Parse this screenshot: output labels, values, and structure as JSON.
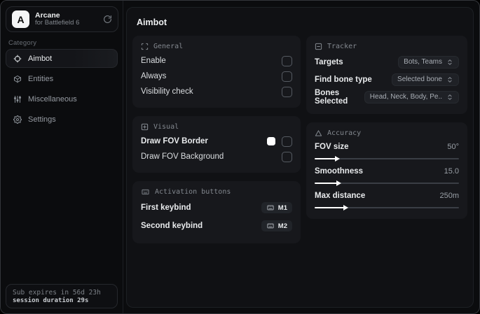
{
  "sidebar": {
    "brand": {
      "logo_letter": "A",
      "name": "Arcane",
      "subtitle": "for Battlefield 6"
    },
    "category_label": "Category",
    "items": [
      {
        "label": "Aimbot"
      },
      {
        "label": "Entities"
      },
      {
        "label": "Miscellaneous"
      },
      {
        "label": "Settings"
      }
    ],
    "subscription": {
      "line1": "Sub expires in 56d 23h",
      "line2": "session duration 29s"
    }
  },
  "main": {
    "title": "Aimbot",
    "general": {
      "title": "General",
      "rows": [
        {
          "label": "Enable",
          "checked": false
        },
        {
          "label": "Always",
          "checked": false
        },
        {
          "label": "Visibility check",
          "checked": false
        }
      ]
    },
    "visual": {
      "title": "Visual",
      "rows": [
        {
          "label": "Draw FOV Border",
          "swatch": "#ffffff",
          "checked": false
        },
        {
          "label": "Draw FOV Background",
          "checked": false
        }
      ]
    },
    "activation": {
      "title": "Activation buttons",
      "rows": [
        {
          "label": "First keybind",
          "key": "M1"
        },
        {
          "label": "Second keybind",
          "key": "M2"
        }
      ]
    },
    "tracker": {
      "title": "Tracker",
      "rows": [
        {
          "label": "Targets",
          "value": "Bots, Teams"
        },
        {
          "label": "Find bone type",
          "value": "Selected bone"
        },
        {
          "label": "Bones Selected",
          "value": "Head, Neck, Body, Pe.."
        }
      ]
    },
    "accuracy": {
      "title": "Accuracy",
      "sliders": [
        {
          "label": "FOV size",
          "value": "50°",
          "fill": 15
        },
        {
          "label": "Smoothness",
          "value": "15.0",
          "fill": 16
        },
        {
          "label": "Max distance",
          "value": "250m",
          "fill": 21
        }
      ]
    }
  }
}
